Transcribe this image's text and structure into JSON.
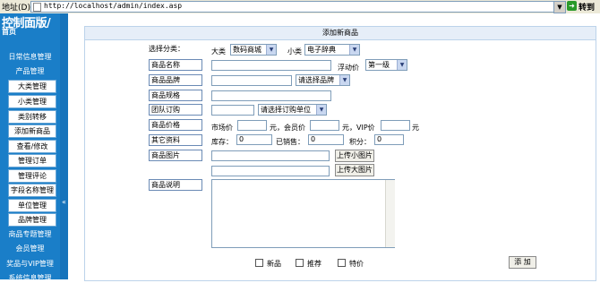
{
  "address_bar": {
    "label": "地址(D)",
    "url": "http://localhost/admin/index.asp",
    "go_label": "转到"
  },
  "sidebar": {
    "title": "控制面版/",
    "home": "首页",
    "groups": [
      "日常信息管理",
      "产品管理",
      "商品专题管理",
      "会员管理",
      "奖品与VIP管理",
      "系统信息管理"
    ],
    "items": [
      "大类管理",
      "小类管理",
      "类别转移",
      "添加新商品",
      "查看/修改",
      "管理订单",
      "管理评论",
      "字段名称管理",
      "单位管理",
      "品牌管理"
    ]
  },
  "form": {
    "title": "添加新商品",
    "category_label": "选择分类：",
    "big_label": "大类",
    "big_value": "数码商城",
    "small_label": "小类",
    "small_value": "电子辞典",
    "fields": {
      "name": "商品名称",
      "brand": "商品品牌",
      "spec": "商品规格",
      "group": "团队订购",
      "price": "商品价格",
      "other": "其它资料",
      "image": "商品图片",
      "desc": "商品说明"
    },
    "float_price_label": "浮动价",
    "float_price_value": "第一级",
    "brand_select": "请选择品牌",
    "unit_select": "请选择订购单位",
    "market_price_label": "市场价",
    "member_price_label": "元，会员价",
    "vip_price_label": "元，VIP价",
    "yuan": "元",
    "stock_label": "库存：",
    "stock_value": "0",
    "sold_label": "已销售：",
    "sold_value": "0",
    "points_label": "积分：",
    "points_value": "0",
    "upload_small": "上传小图片",
    "upload_big": "上传大图片",
    "check_new": "新品",
    "check_recommend": "推荐",
    "check_special": "特价",
    "submit": "添 加"
  }
}
